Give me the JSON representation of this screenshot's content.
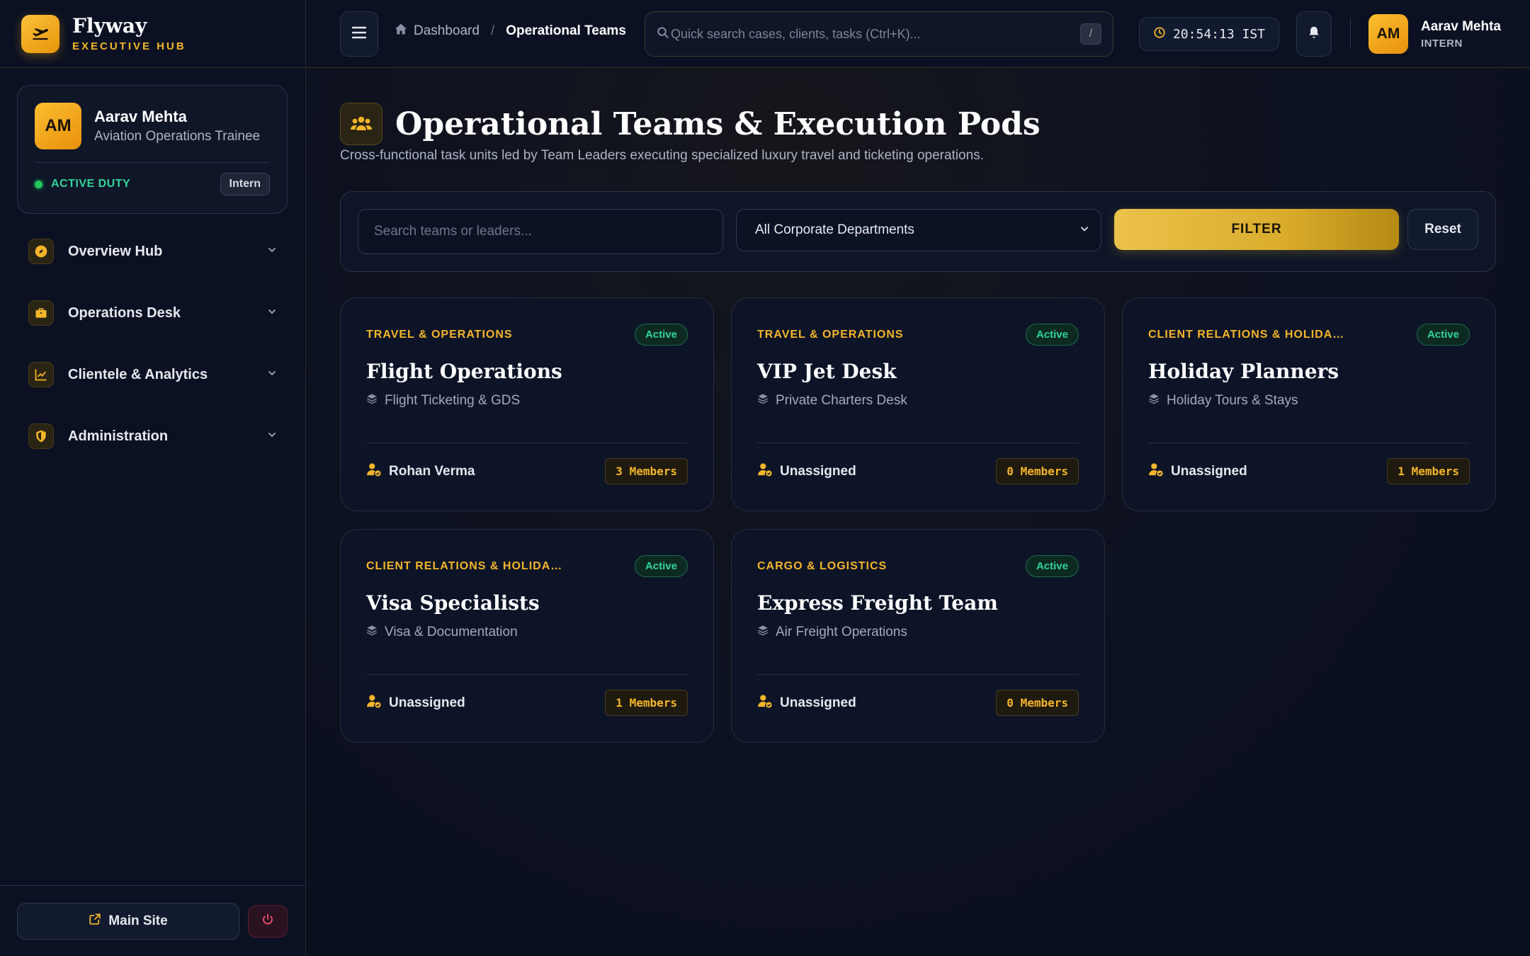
{
  "brand": {
    "name": "Flyway",
    "subtitle": "EXECUTIVE HUB"
  },
  "profile": {
    "initials": "AM",
    "name": "Aarav Mehta",
    "role": "Aviation Operations Trainee",
    "status": "ACTIVE DUTY",
    "badge": "Intern"
  },
  "nav": [
    {
      "label": "Overview Hub",
      "icon": "compass-icon"
    },
    {
      "label": "Operations Desk",
      "icon": "briefcase-icon"
    },
    {
      "label": "Clientele & Analytics",
      "icon": "chart-icon"
    },
    {
      "label": "Administration",
      "icon": "shield-icon"
    }
  ],
  "footer": {
    "main_site": "Main Site"
  },
  "topbar": {
    "breadcrumb_home": "Dashboard",
    "breadcrumb_current": "Operational Teams",
    "search_placeholder": "Quick search cases, clients, tasks (Ctrl+K)...",
    "search_shortcut": "/",
    "clock": "20:54:13 IST",
    "user_initials": "AM",
    "user_name": "Aarav Mehta",
    "user_role": "INTERN"
  },
  "page": {
    "title": "Operational Teams & Execution Pods",
    "subtitle": "Cross-functional task units led by Team Leaders executing specialized luxury travel and ticketing operations."
  },
  "filters": {
    "search_placeholder": "Search teams or leaders...",
    "department_selected": "All Corporate Departments",
    "filter_label": "FILTER",
    "reset_label": "Reset"
  },
  "teams": [
    {
      "department": "TRAVEL & OPERATIONS",
      "status": "Active",
      "name": "Flight Operations",
      "service": "Flight Ticketing & GDS",
      "leader": "Rohan Verma",
      "members": "3 Members"
    },
    {
      "department": "TRAVEL & OPERATIONS",
      "status": "Active",
      "name": "VIP Jet Desk",
      "service": "Private Charters Desk",
      "leader": "Unassigned",
      "members": "0 Members"
    },
    {
      "department": "CLIENT RELATIONS & HOLIDA…",
      "status": "Active",
      "name": "Holiday Planners",
      "service": "Holiday Tours & Stays",
      "leader": "Unassigned",
      "members": "1 Members"
    },
    {
      "department": "CLIENT RELATIONS & HOLIDA…",
      "status": "Active",
      "name": "Visa Specialists",
      "service": "Visa & Documentation",
      "leader": "Unassigned",
      "members": "1 Members"
    },
    {
      "department": "CARGO & LOGISTICS",
      "status": "Active",
      "name": "Express Freight Team",
      "service": "Air Freight Operations",
      "leader": "Unassigned",
      "members": "0 Members"
    }
  ],
  "colors": {
    "accent": "#f4b52a",
    "active": "#34d399",
    "background": "#0a0f1d"
  }
}
